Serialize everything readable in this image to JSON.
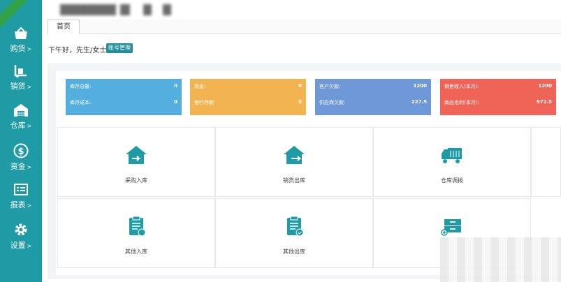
{
  "ribbon": "",
  "sidebar": {
    "items": [
      {
        "label": "购货",
        "icon": "basket-icon"
      },
      {
        "label": "销货",
        "icon": "dolly-icon"
      },
      {
        "label": "仓库",
        "icon": "warehouse-icon"
      },
      {
        "label": "资金",
        "icon": "dollar-circle-icon"
      },
      {
        "label": "报表",
        "icon": "report-icon"
      },
      {
        "label": "设置",
        "icon": "gear-icon"
      }
    ],
    "arrow": ">"
  },
  "tabs": {
    "home": "首页",
    "dropdown": "▾"
  },
  "greeting": "下午好，先生/女士",
  "account_button": "账号管理",
  "colors": {
    "sidebar": "#1f9ba6",
    "stat_blue": "#55aee0",
    "stat_orange": "#f2b450",
    "stat_indigo": "#6f98d8",
    "stat_red": "#ef6457",
    "icon_teal": "#1f9ba6"
  },
  "stats": [
    {
      "rows": [
        {
          "label": "库存总量:",
          "value": "0"
        },
        {
          "label": "库存成本:",
          "value": "0"
        }
      ]
    },
    {
      "rows": [
        {
          "label": "现金:",
          "value": "0"
        },
        {
          "label": "银行存款:",
          "value": "5"
        }
      ]
    },
    {
      "rows": [
        {
          "label": "客户欠款:",
          "value": "1200"
        },
        {
          "label": "供应商欠款:",
          "value": "227.5"
        }
      ]
    },
    {
      "rows": [
        {
          "label": "销售收入(本月):",
          "value": "1200"
        },
        {
          "label": "商品毛利(本月):",
          "value": "972.5"
        }
      ]
    }
  ],
  "tiles": [
    {
      "label": "采购入库",
      "icon": "house-arrow-in-icon"
    },
    {
      "label": "销货出库",
      "icon": "house-arrow-out-icon"
    },
    {
      "label": "仓库调拨",
      "icon": "truck-icon"
    },
    {
      "label": "其他入库",
      "icon": "clipboard-in-icon"
    },
    {
      "label": "其他出库",
      "icon": "clipboard-out-icon"
    },
    {
      "label": "",
      "icon": "drawer-plus-icon"
    }
  ]
}
